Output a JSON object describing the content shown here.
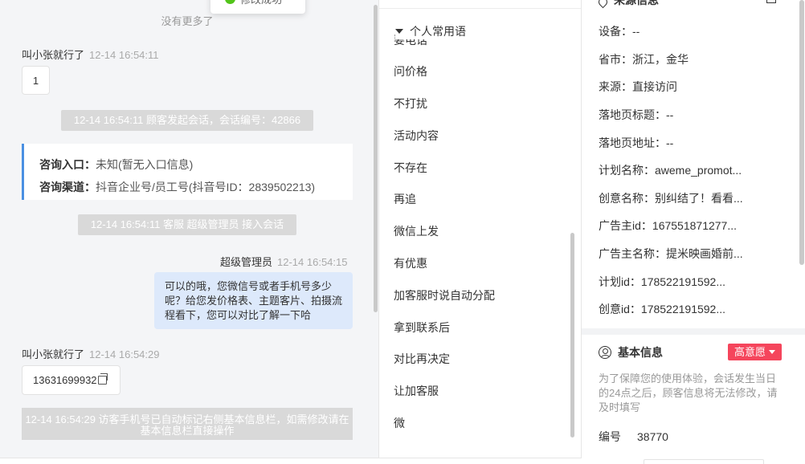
{
  "toast": {
    "text": "修改成功"
  },
  "chat": {
    "no_more": "没有更多了",
    "msg1": {
      "sender": "叫小张就行了",
      "time": "12-14 16:54:11",
      "text": "1"
    },
    "sys1": "12-14 16:54:11 顾客发起会话，会话编号：42866",
    "info_card": {
      "entry_label": "咨询入口：",
      "entry_value": "未知(暂无入口信息)",
      "channel_label": "咨询渠道：",
      "channel_value": "抖音企业号/员工号(抖音号ID：2839502213)"
    },
    "sys2": "12-14 16:54:11 客服 超级管理员 接入会话",
    "msg2": {
      "sender": "超级管理员",
      "time": "12-14 16:54:15",
      "text": "可以的哦，您微信号或者手机号多少呢？给您发价格表、主题客片、拍摄流程看下，您可以对比了解一下哈"
    },
    "msg3": {
      "sender": "叫小张就行了",
      "time": "12-14 16:54:29",
      "text": "13631699932"
    },
    "sys3": "12-14 16:54:29 访客手机号已自动标记右侧基本信息栏，如需修改请在基本信息栏直接操作"
  },
  "phrases": {
    "header": "个人常用语",
    "peek": "要电话",
    "items": [
      "问价格",
      "不打扰",
      "活动内容",
      "不存在",
      "再追",
      "微信上发",
      "有优惠",
      "加客服时说自动分配",
      "拿到联系后",
      "对比再决定",
      "让加客服",
      "微"
    ]
  },
  "info": {
    "source_title": "来源信息",
    "rows": [
      {
        "label": "设备：",
        "value": "--"
      },
      {
        "label": "省市：",
        "value": "浙江，金华"
      },
      {
        "label": "来源：",
        "value": "直接访问"
      },
      {
        "label": "落地页标题：",
        "value": "--"
      },
      {
        "label": "落地页地址：",
        "value": "--"
      },
      {
        "label": "计划名称：",
        "value": "aweme_promot..."
      },
      {
        "label": "创意名称：",
        "value": "别纠结了！看看..."
      },
      {
        "label": "广告主id：",
        "value": "167551871277..."
      },
      {
        "label": "广告主名称：",
        "value": "提米映画婚前..."
      },
      {
        "label": "计划id：",
        "value": "178522191592..."
      },
      {
        "label": "创意id：",
        "value": "178522191592..."
      }
    ],
    "basic_title": "基本信息",
    "intent_badge": "高意愿",
    "hint": "为了保障您的使用体验，会话发生当日的24点之后，顾客信息将无法修改，请及时填写",
    "number_label": "编号",
    "number_value": "38770"
  },
  "colors": {
    "accent_blue": "#4a90e2",
    "badge_red": "#f5455c",
    "bubble_out": "#dde9fb",
    "system_gray": "#d9d9d9"
  }
}
